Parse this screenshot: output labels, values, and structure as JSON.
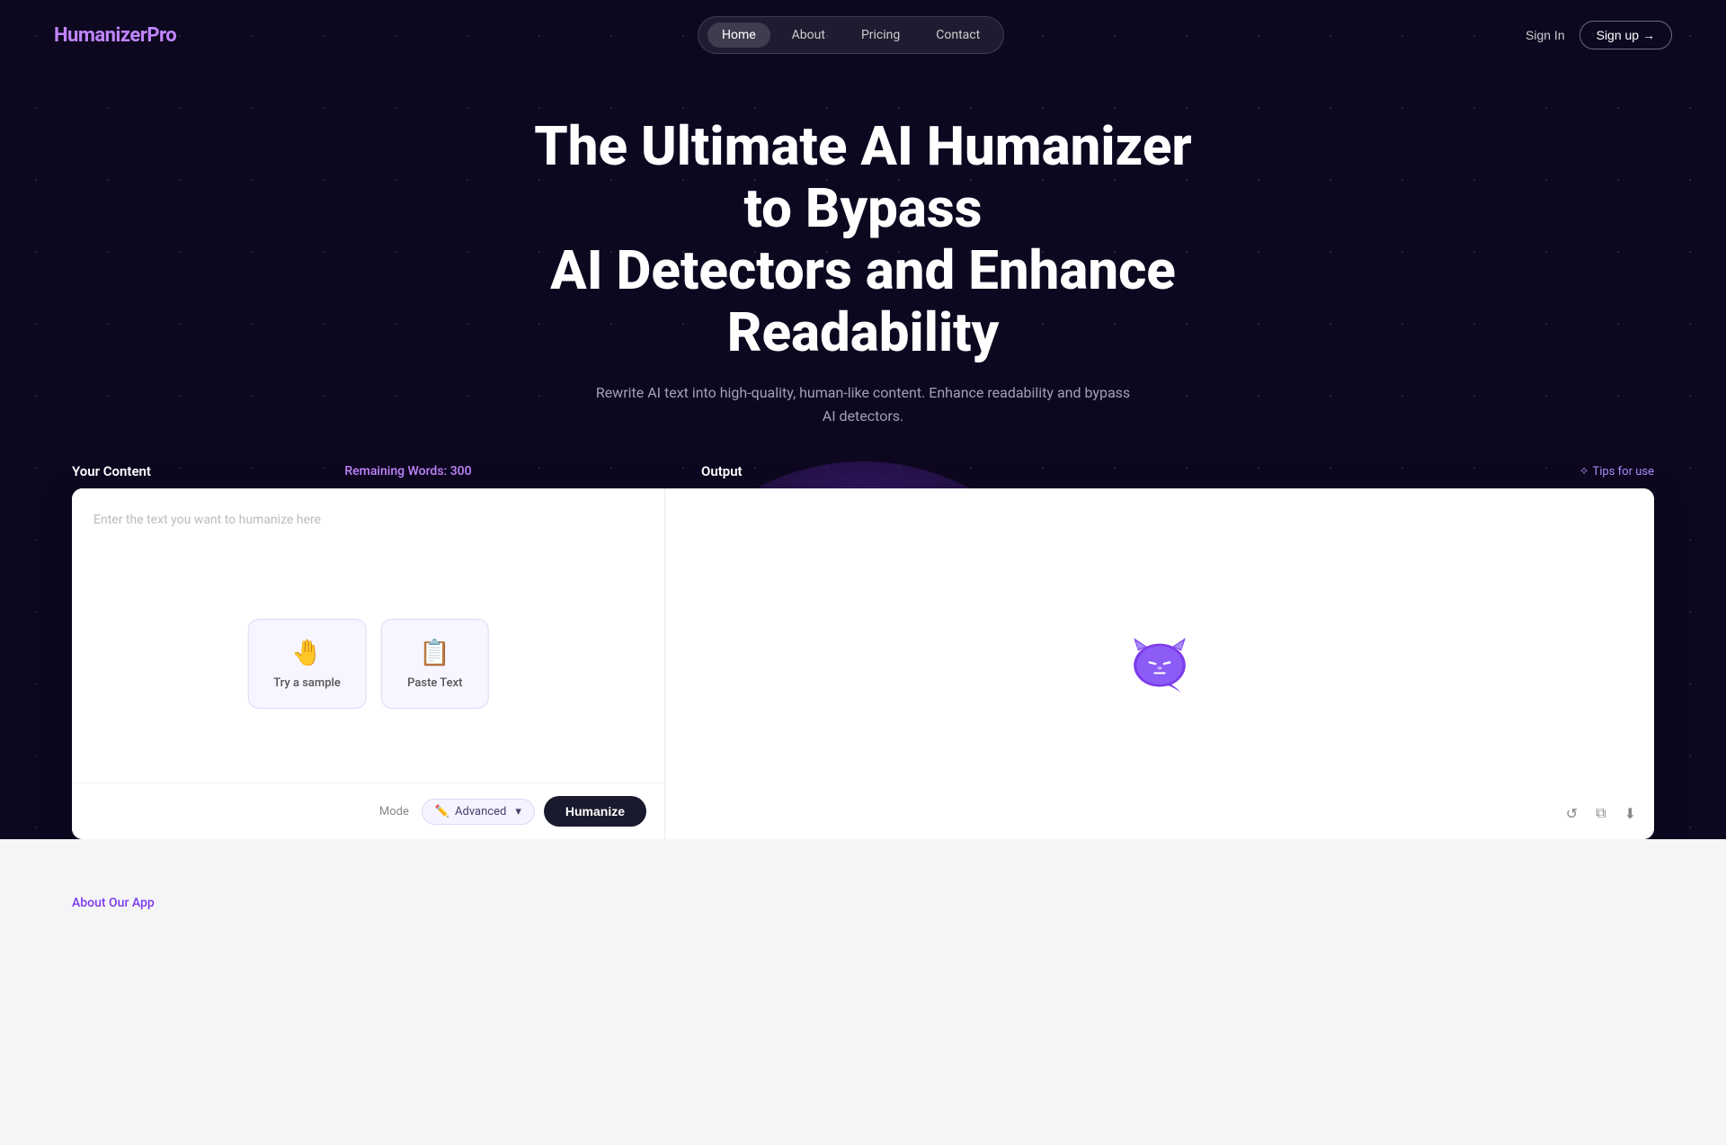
{
  "brand": {
    "name_white": "Humanizer",
    "name_purple": "Pro"
  },
  "navbar": {
    "links": [
      {
        "label": "Home",
        "active": true
      },
      {
        "label": "About",
        "active": false
      },
      {
        "label": "Pricing",
        "active": false
      },
      {
        "label": "Contact",
        "active": false
      }
    ],
    "sign_in": "Sign In",
    "sign_up": "Sign up →"
  },
  "hero": {
    "title_line1": "The Ultimate AI Humanizer to Bypass",
    "title_line2": "AI Detectors and Enhance Readability",
    "subtitle": "Rewrite AI text into high-quality, human-like content. Enhance readability and bypass AI detectors."
  },
  "editor": {
    "input_label": "Your Content",
    "remaining_label": "Remaining Words: 300",
    "output_label": "Output",
    "tips_label": "Tips for use",
    "input_placeholder": "Enter the text you want to humanize here",
    "try_sample_label": "Try a sample",
    "paste_text_label": "Paste Text",
    "mode_label": "Mode",
    "mode_value": "Advanced",
    "humanize_btn": "Humanize"
  },
  "output_tools": {
    "refresh": "↺",
    "copy": "⧉",
    "download": "⬇"
  },
  "bottom": {
    "about_label": "About Our App"
  }
}
